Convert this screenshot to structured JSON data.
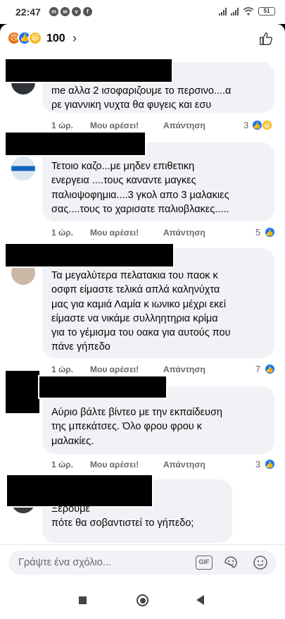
{
  "status_bar": {
    "time": "22:47",
    "icons": [
      "messenger-icon",
      "whatsapp-icon",
      "viber-icon",
      "facebook-icon"
    ],
    "battery": "51"
  },
  "header": {
    "reactions": [
      "angry",
      "like",
      "haha"
    ],
    "reaction_count": "100",
    "chevron": "›"
  },
  "comments": [
    {
      "text": "me αλλα 2 ισοφαριζουμε το περσινο....α\nρε γιαννικη νυχτα θα φυγεις και εσυ",
      "time": "1 ώρ.",
      "like": "Μου αρέσει!",
      "reply": "Απάντηση",
      "reaction_count": "3",
      "reactions": [
        "like",
        "haha"
      ]
    },
    {
      "text": "Τετοιο καζο...με μηδεν επιθετικη\nενεργεια ....τους καναντε μαγκες\nπαλιοψοφημια....3 γκολ απο 3 μαλακιες\nσας....τους το χαρισατε παλιοβλακες.....",
      "time": "1 ώρ.",
      "like": "Μου αρέσει!",
      "reply": "Απάντηση",
      "reaction_count": "5",
      "reactions": [
        "like"
      ]
    },
    {
      "text": "Τα μεγαλύτερα πελατακια του παοκ κ\nοσφπ είμαστε  τελικά απλά καληνύχτα\nμας για καμιά Λαμία κ ιωνικο μέχρι εκεί\nείμαστε να νικάμε συλληητηρια κρίμα\nγια το γέμισμα του οακα για αυτούς που\nπάνε γήπεδο",
      "time": "1 ώρ.",
      "like": "Μου αρέσει!",
      "reply": "Απάντηση",
      "reaction_count": "7",
      "reactions": [
        "like"
      ]
    },
    {
      "text": "Αύριο βάλτε βίντεο με την εκπαίδευση\nτης μπεκάτσες. Όλο φρου φρου κ\nμαλακίες.",
      "time": "1 ώρ.",
      "like": "Μου αρέσει!",
      "reply": "Απάντηση",
      "reaction_count": "3",
      "reactions": [
        "like"
      ]
    },
    {
      "text": "Ξέρουμε\nπότε θα σοβαντιστεί το γήπεδο;",
      "time": "",
      "like": "",
      "reply": "",
      "reaction_count": "",
      "reactions": []
    }
  ],
  "composer": {
    "placeholder": "Γράψτε ένα σχόλιο...",
    "gif_label": "GIF"
  },
  "colors": {
    "bubble": "#f0f2f5",
    "meta": "#65676b",
    "like_blue": "#1877f2",
    "haha_yellow": "#f7b928",
    "angry_orange": "#e9710f"
  }
}
